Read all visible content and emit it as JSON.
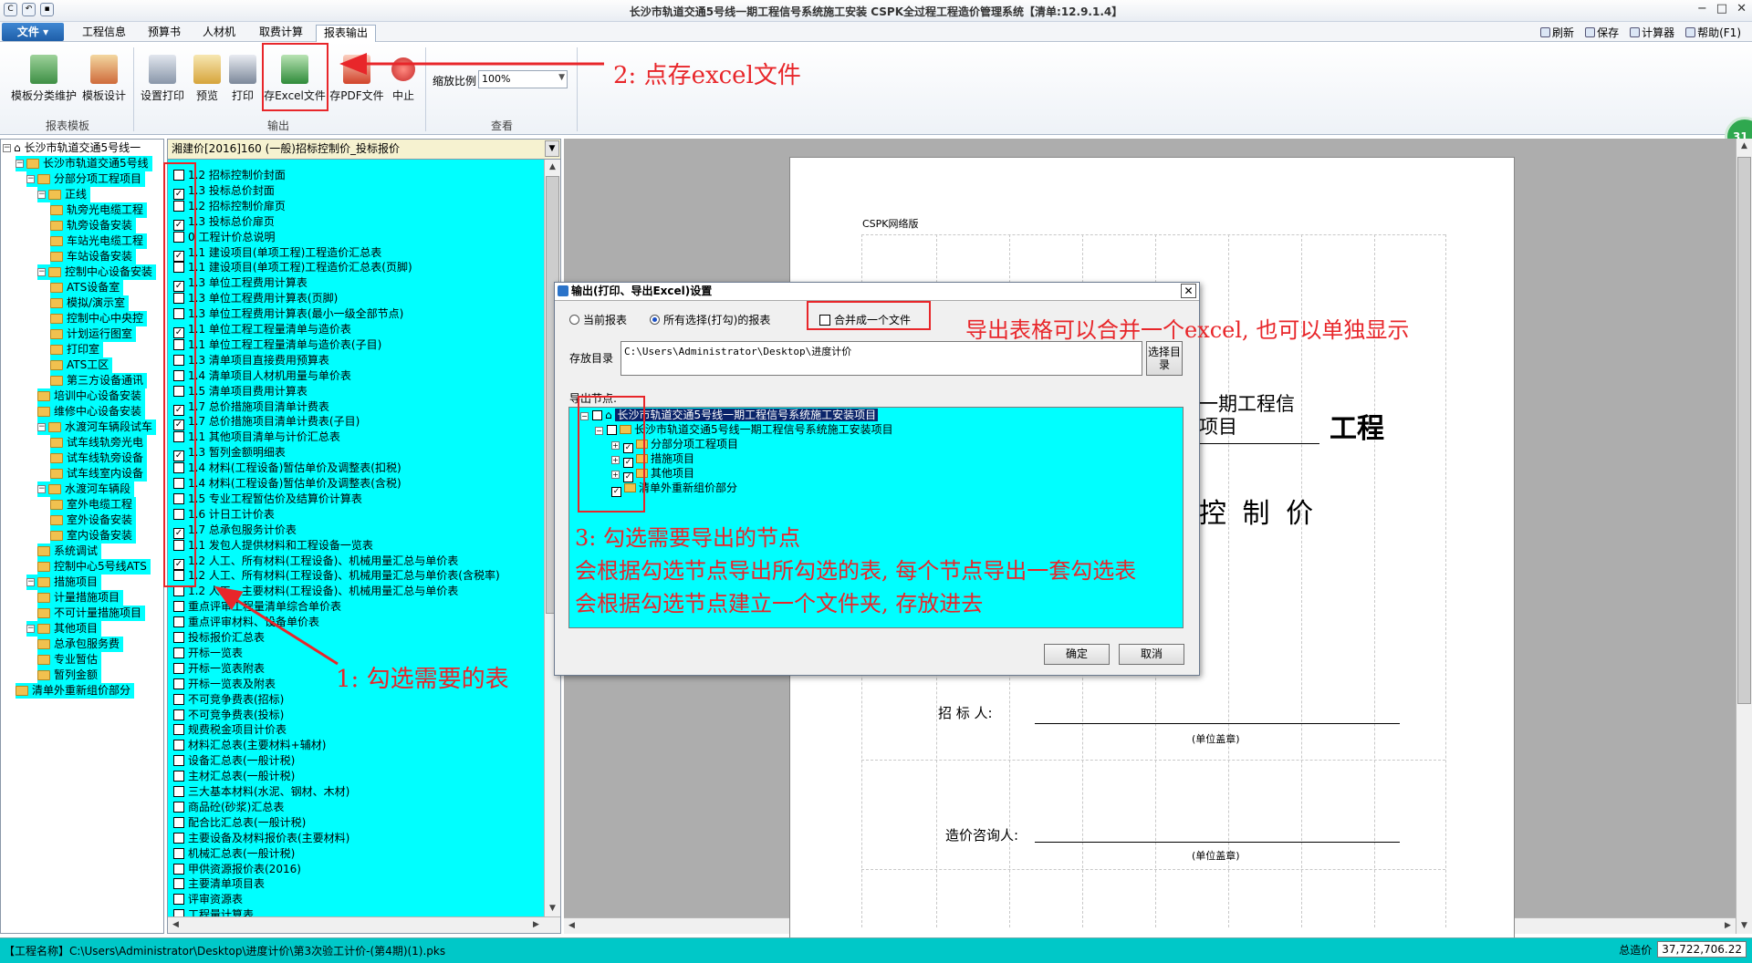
{
  "window": {
    "title": "长沙市轨道交通5号线一期工程信号系统施工安装    CSPK全过程工程造价管理系统【清单:12.9.1.4】"
  },
  "menu": {
    "file": "文件",
    "tabs": [
      "工程信息",
      "预算书",
      "人材机",
      "取费计算",
      "报表输出"
    ],
    "active_tab": "报表输出",
    "right_tools": [
      "刷新",
      "保存",
      "计算器",
      "帮助(F1)"
    ]
  },
  "ribbon": {
    "buttons": [
      "模板分类维护",
      "模板设计",
      "设置打印",
      "预览",
      "打印",
      "存Excel文件",
      "存PDF文件",
      "中止"
    ],
    "groups": [
      "报表模板",
      "输出",
      "查看"
    ],
    "zoom_label": "缩放比例",
    "zoom_value": "100%",
    "badge": "31"
  },
  "left_tree": {
    "nodes": [
      "长沙市轨道交通5号线一",
      "长沙市轨道交通5号线",
      "分部分项工程项目",
      "正线",
      "轨旁光电缆工程",
      "轨旁设备安装",
      "车站光电缆工程",
      "车站设备安装",
      "控制中心设备安装",
      "ATS设备室",
      "模拟/演示室",
      "控制中心中央控",
      "计划运行图室",
      "打印室",
      "ATS工区",
      "第三方设备通讯",
      "培训中心设备安装",
      "维修中心设备安装",
      "水渡河车辆段试车",
      "试车线轨旁光电",
      "试车线轨旁设备",
      "试车线室内设备",
      "水渡河车辆段",
      "室外电缆工程",
      "室外设备安装",
      "室内设备安装",
      "系统调试",
      "控制中心5号线ATS",
      "措施项目",
      "计量措施项目",
      "不可计量措施项目",
      "其他项目",
      "总承包服务费",
      "专业暂估",
      "暂列金额",
      "清单外重新组价部分"
    ]
  },
  "report_list": {
    "combo": "湘建价[2016]160 (一般)招标控制价_投标报价",
    "items": [
      {
        "label": "1.2 招标控制价封面",
        "checked": false
      },
      {
        "label": "1.3 投标总价封面",
        "checked": true
      },
      {
        "label": "1.2 招标控制价扉页",
        "checked": false
      },
      {
        "label": "1.3 投标总价扉页",
        "checked": true
      },
      {
        "label": "0 工程计价总说明",
        "checked": false
      },
      {
        "label": "1.1 建设项目(单项工程)工程造价汇总表",
        "checked": true
      },
      {
        "label": "1.1 建设项目(单项工程)工程造价汇总表(页脚)",
        "checked": false
      },
      {
        "label": "1.3 单位工程费用计算表",
        "checked": true
      },
      {
        "label": "1.3 单位工程费用计算表(页脚)",
        "checked": false
      },
      {
        "label": "1.3 单位工程费用计算表(最小一级全部节点)",
        "checked": false
      },
      {
        "label": "1.1 单位工程工程量清单与造价表",
        "checked": true
      },
      {
        "label": "1.1 单位工程工程量清单与造价表(子目)",
        "checked": false
      },
      {
        "label": "1.3 清单项目直接费用预算表",
        "checked": false
      },
      {
        "label": "1.4 清单项目人材机用量与单价表",
        "checked": false
      },
      {
        "label": "1.5 清单项目费用计算表",
        "checked": false
      },
      {
        "label": "1.7 总价措施项目清单计费表",
        "checked": true
      },
      {
        "label": "1.7 总价措施项目清单计费表(子目)",
        "checked": true
      },
      {
        "label": "1.1 其他项目清单与计价汇总表",
        "checked": false
      },
      {
        "label": "1.3 暂列金额明细表",
        "checked": true
      },
      {
        "label": "1.4 材料(工程设备)暂估单价及调整表(扣税)",
        "checked": false
      },
      {
        "label": "1.4 材料(工程设备)暂估单价及调整表(含税)",
        "checked": false
      },
      {
        "label": "1.5 专业工程暂估价及结算价计算表",
        "checked": false
      },
      {
        "label": "1.6 计日工计价表",
        "checked": false
      },
      {
        "label": "1.7 总承包服务计价表",
        "checked": true
      },
      {
        "label": "1.1 发包人提供材料和工程设备一览表",
        "checked": false
      },
      {
        "label": "1.2 人工、所有材料(工程设备)、机械用量汇总与单价表",
        "checked": true
      },
      {
        "label": "1.2 人工、所有材料(工程设备)、机械用量汇总与单价表(含税率)",
        "checked": false
      },
      {
        "label": "1.2 人工、主要材料(工程设备)、机械用量汇总与单价表",
        "checked": false
      },
      {
        "label": "重点评审工程量清单综合单价表",
        "checked": false
      },
      {
        "label": "重点评审材料、设备单价表",
        "checked": false
      },
      {
        "label": "投标报价汇总表",
        "checked": false
      },
      {
        "label": "开标一览表",
        "checked": false
      },
      {
        "label": "开标一览表附表",
        "checked": false
      },
      {
        "label": "开标一览表及附表",
        "checked": false
      },
      {
        "label": "不可竞争费表(招标)",
        "checked": false
      },
      {
        "label": "不可竞争费表(投标)",
        "checked": false
      },
      {
        "label": "规费税金项目计价表",
        "checked": false
      },
      {
        "label": "材料汇总表(主要材料+辅材)",
        "checked": false
      },
      {
        "label": "设备汇总表(一般计税)",
        "checked": false
      },
      {
        "label": "主材汇总表(一般计税)",
        "checked": false
      },
      {
        "label": "三大基本材料(水泥、钢材、木材)",
        "checked": false
      },
      {
        "label": "商品砼(砂浆)汇总表",
        "checked": false
      },
      {
        "label": "配合比汇总表(一般计税)",
        "checked": false
      },
      {
        "label": "主要设备及材料报价表(主要材料)",
        "checked": false
      },
      {
        "label": "机械汇总表(一般计税)",
        "checked": false
      },
      {
        "label": "甲供资源报价表(2016)",
        "checked": false
      },
      {
        "label": "主要清单项目表",
        "checked": false
      },
      {
        "label": "评审资源表",
        "checked": false
      },
      {
        "label": "工程量计算表",
        "checked": false
      }
    ]
  },
  "preview": {
    "net_label": "CSPK网络版",
    "title_part1": "一期工程信",
    "title_part2": "工程",
    "title_part3": "项目",
    "subtitle": "控 制 价",
    "zhaobiao_label": "招  标  人:",
    "seal1": "(单位盖章)",
    "consult_label": "造价咨询人:",
    "seal2": "(单位盖章)"
  },
  "dialog": {
    "title": "输出(打印、导出Excel)设置",
    "radio_current": "当前报表",
    "radio_all": "所有选择(打勾)的报表",
    "merge_label": "合并成一个文件",
    "merge_checked": false,
    "dir_label": "存放目录",
    "dir_value": "C:\\Users\\Administrator\\Desktop\\进度计价",
    "choose_dir_btn": "选择目录",
    "nodes_label": "导出节点:",
    "nodes": [
      {
        "label": "长沙市轨道交通5号线一期工程信号系统施工安装项目",
        "checked": false,
        "selected": true
      },
      {
        "label": "长沙市轨道交通5号线一期工程信号系统施工安装项目",
        "checked": false
      },
      {
        "label": "分部分项工程项目",
        "checked": true
      },
      {
        "label": "措施项目",
        "checked": true
      },
      {
        "label": "其他项目",
        "checked": true
      },
      {
        "label": "清单外重新组价部分",
        "checked": true
      }
    ],
    "ok": "确定",
    "cancel": "取消"
  },
  "annotations": {
    "step1": "1: 勾选需要的表",
    "step2": "2: 点存excel文件",
    "merge_note": "导出表格可以合并一个excel, 也可以单独显示",
    "step3_line1": "3: 勾选需要导出的节点",
    "step3_line2": "会根据勾选节点导出所勾选的表, 每个节点导出一套勾选表",
    "step3_line3": "会根据勾选节点建立一个文件夹, 存放进去"
  },
  "status": {
    "left": "【工程名称】C:\\Users\\Administrator\\Desktop\\进度计价\\第3次验工计价-(第4期)(1).pks",
    "total_label": "总造价",
    "total_value": "37,722,706.22"
  },
  "colors": {
    "highlight": "#00ffff",
    "annotation": "#e8262a",
    "dialog_bg": "#f0f0f0"
  }
}
